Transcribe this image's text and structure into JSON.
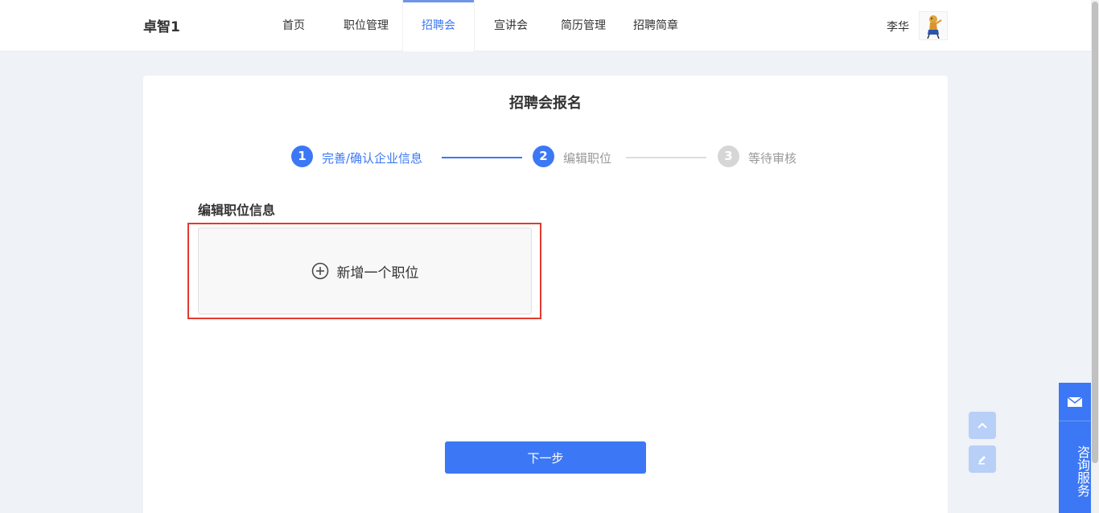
{
  "header": {
    "brand": "卓智1",
    "nav": [
      "首页",
      "职位管理",
      "招聘会",
      "宣讲会",
      "简历管理",
      "招聘简章"
    ],
    "active_index": 2,
    "username": "李华"
  },
  "page": {
    "title": "招聘会报名",
    "steps": [
      {
        "number": "1",
        "label": "完善/确认企业信息",
        "status": "done"
      },
      {
        "number": "2",
        "label": "编辑职位",
        "status": "current"
      },
      {
        "number": "3",
        "label": "等待审核",
        "status": "pending"
      }
    ],
    "section_title": "编辑职位信息",
    "add_position_label": "新增一个职位",
    "next_button": "下一步"
  },
  "sidebar_tools": {
    "back_to_top_icon": "chevron-up-icon",
    "edit_icon": "pencil-icon",
    "consult_icon": "envelope-icon",
    "consult_label": "咨询服务"
  },
  "colors": {
    "accent": "#3c78f5",
    "highlight": "#e23a2e",
    "background": "#eff2f6"
  }
}
